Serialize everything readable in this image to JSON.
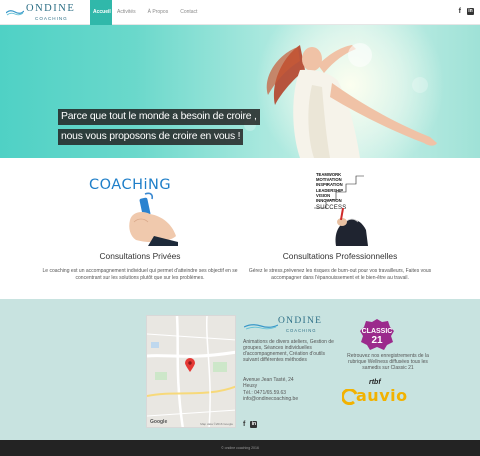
{
  "brand": {
    "name": "ONDINE",
    "tagline": "COACHING"
  },
  "nav": {
    "items": [
      "Accueil",
      "Activités",
      "À Propos",
      "Contact"
    ]
  },
  "hero": {
    "caption_lines": [
      "Parce que tout le monde a besoin de croire ,",
      "nous vous proposons de croire en vous !"
    ]
  },
  "services": {
    "private": {
      "image_text": "COACHiNG",
      "title": "Consultations Privées",
      "desc": "Le coaching est un accompagnement individuel qui permet d'atteindre ses objectif en se concentrant sur les solutions plutôt que sur les problèmes."
    },
    "pro": {
      "image_words": [
        "TEAMWORK",
        "MOTIVATION",
        "INSPIRATION",
        "LEADERSHIP",
        "VISION",
        "INNOVATION"
      ],
      "image_success": "SUCCESS",
      "title": "Consultations Professionnelles",
      "desc": "Gérez le stress,prévenez les risques de burn-out pour vos travailleurs, Faites vous accompagner dans l'épanouissement et le bien-être au travail."
    }
  },
  "info": {
    "map_footer": "Map data ©2016 Google",
    "map_logo": "Google",
    "description": "Animations de divers ateliers, Gestion de groupes, Séances individuelles d'accompagnement, Création d'outils suivant différentes méthodes",
    "address": [
      "Avenue Jean Tasté, 24",
      "Heusy",
      "Tél.: 0471/65.59.63",
      "info@ondinecoaching.be"
    ],
    "classic21_text": "Retrouvez nos enregistrements de la rubrique Wellness diffusées tous les samedis sur Classic 21",
    "rtbf_label": "rtbf",
    "auvio_label": "auvio"
  },
  "footer": {
    "copyright": "© ondine coaching 2016"
  },
  "colors": {
    "accent": "#30b8aa",
    "info_bg": "#c8e3e0",
    "footer_bg": "#232323",
    "brand_blue": "#2d6f86"
  },
  "icons": {
    "facebook": "facebook-icon",
    "linkedin": "linkedin-icon"
  }
}
